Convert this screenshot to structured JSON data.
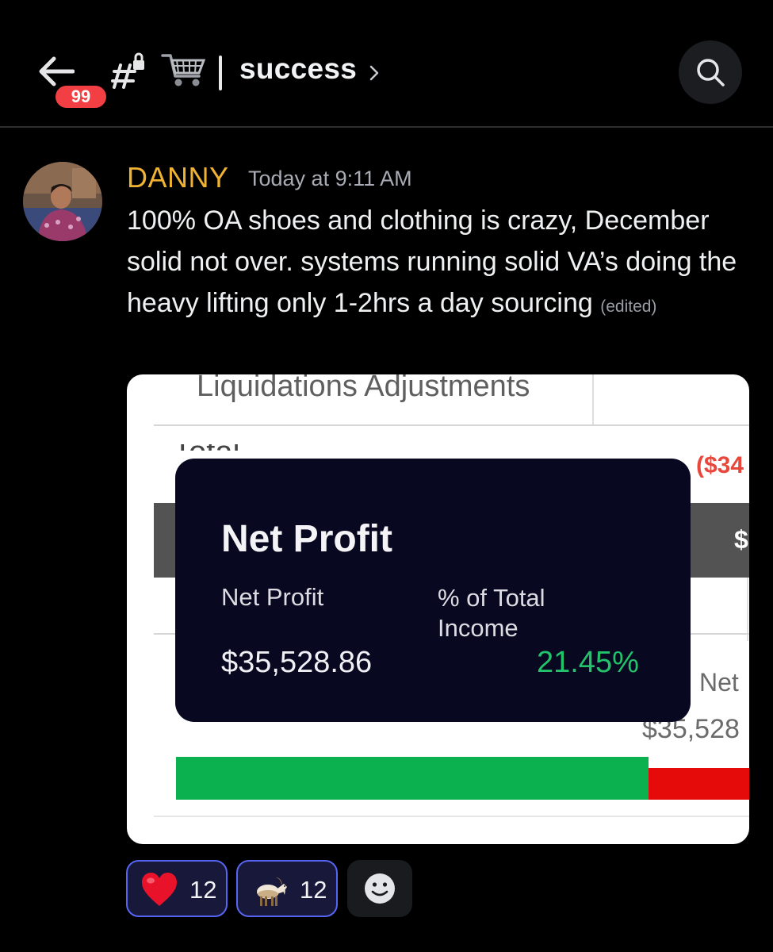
{
  "header": {
    "unread_badge": "99",
    "channel_name": "success"
  },
  "message": {
    "author": "DANNY",
    "timestamp": "Today at 9:11 AM",
    "text": "100% OA shoes and clothing is crazy, December solid not over. systems running solid VA’s doing the heavy lifting only 1-2hrs a day sourcing",
    "edited_label": "(edited)"
  },
  "attachment": {
    "header_text": "Liquidations Adjustments",
    "total_fragment": "Total",
    "red_value_fragment": "($34",
    "dark_bar_fragment": "$",
    "net_label_fragment": "Net",
    "net_value_fragment": "$35,528",
    "tooltip": {
      "title": "Net Profit",
      "label_net_profit": "Net Profit",
      "label_pct_income": "% of Total Income",
      "value_net_profit": "$35,528.86",
      "value_pct_income": "21.45%"
    },
    "profit_bar_fraction": 0.79
  },
  "reactions": [
    {
      "emoji": "heart-emoji",
      "count": "12"
    },
    {
      "emoji": "goat-emoji",
      "count": "12"
    }
  ],
  "colors": {
    "author": "#f0b232",
    "badge": "#f23f43",
    "reaction_border": "#5865f2",
    "profit_green": "#0ab14e",
    "loss_red": "#e50b0b",
    "pct_green": "#22c36a"
  }
}
